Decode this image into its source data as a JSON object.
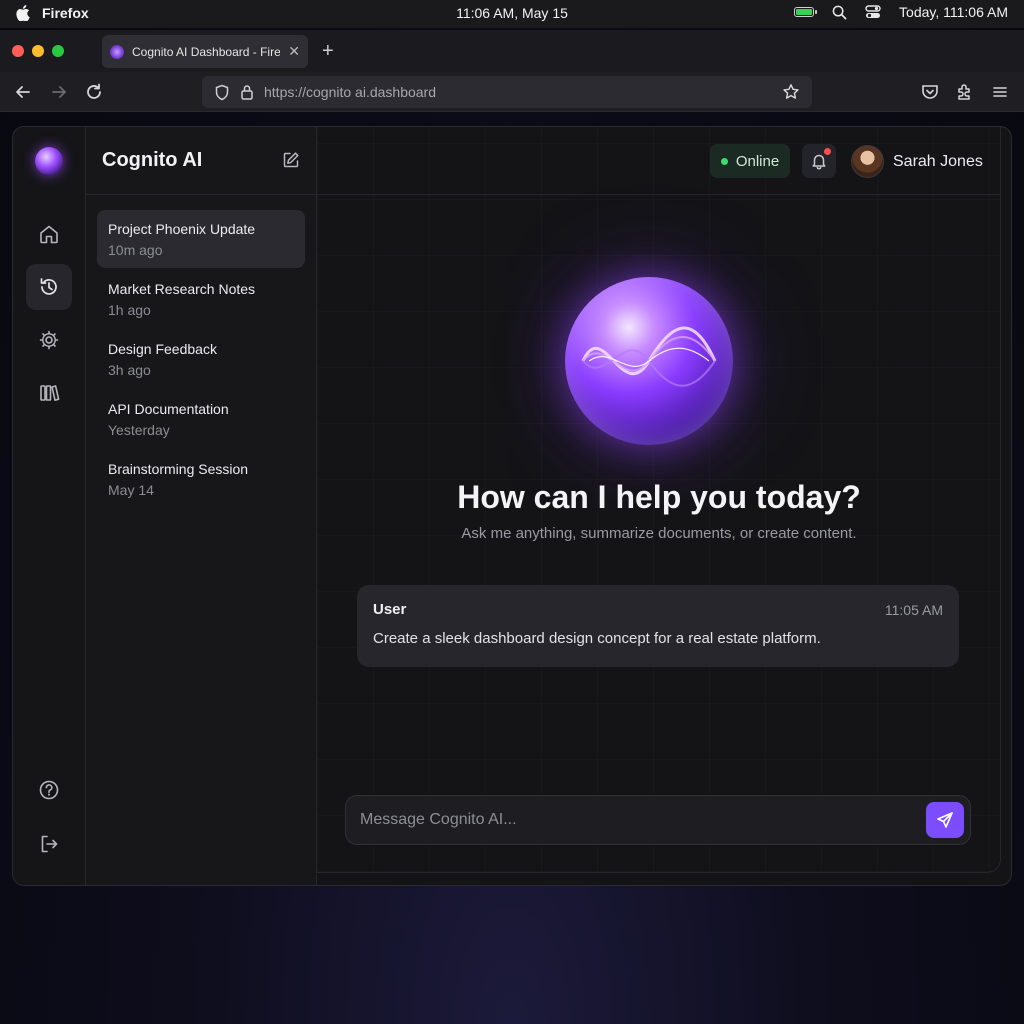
{
  "menubar": {
    "app_name": "Firefox",
    "clock": "11:06 AM, May 15",
    "right_clock": "Today, 111:06 AM"
  },
  "browser": {
    "tab_title": "Cognito AI Dashboard - Firefox",
    "url": "https://cognito ai.dashboard"
  },
  "sidebar": {
    "brand": "Cognito AI",
    "nav": [
      "home-icon",
      "history-icon",
      "settings-icon",
      "library-icon",
      "help-icon",
      "logout-icon"
    ],
    "conversations": [
      {
        "title": "Project Phoenix Update",
        "subtitle": "10m ago",
        "active": true
      },
      {
        "title": "Market Research Notes",
        "subtitle": "1h ago",
        "active": false
      },
      {
        "title": "Design Feedback",
        "subtitle": "3h ago",
        "active": false
      },
      {
        "title": "API Documentation",
        "subtitle": "Yesterday",
        "active": false
      },
      {
        "title": "Brainstorming Session",
        "subtitle": "May 14",
        "active": false
      }
    ]
  },
  "header": {
    "status": "Online",
    "user_name": "Sarah Jones"
  },
  "hero": {
    "heading": "How can I help you today?",
    "subheading": "Ask me anything, summarize documents, or create content."
  },
  "message": {
    "author": "User",
    "time": "11:05 AM",
    "text": "Create a sleek dashboard design concept for a real estate platform."
  },
  "composer": {
    "placeholder": "Message Cognito AI..."
  },
  "colors": {
    "accent": "#7b4dff",
    "online": "#3ddc6e",
    "notification": "#ff4b4b"
  }
}
